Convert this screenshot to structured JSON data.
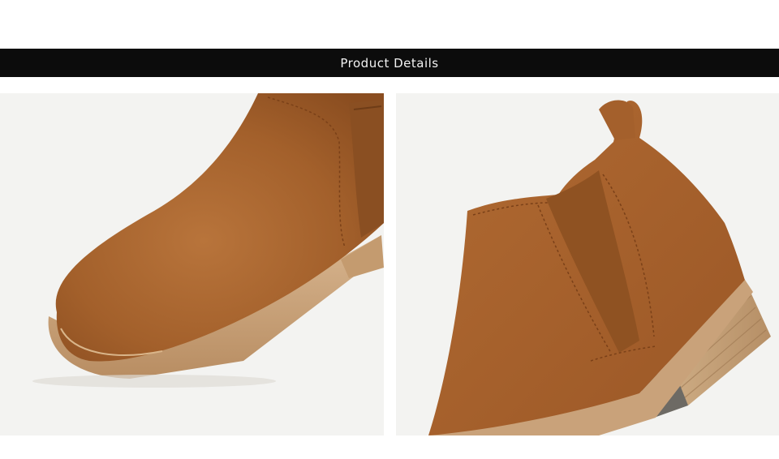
{
  "header": {
    "title": "Product Details"
  },
  "photos": [
    {
      "name": "boot-toe-closeup",
      "alt": ""
    },
    {
      "name": "boot-heel-closeup",
      "alt": ""
    }
  ],
  "colors": {
    "banner_bg": "#0c0c0c",
    "banner_text": "#f2f2f2",
    "suede": "#a8652f",
    "sole": "#c9a27a",
    "photo_bg": "#f3f3f1"
  }
}
